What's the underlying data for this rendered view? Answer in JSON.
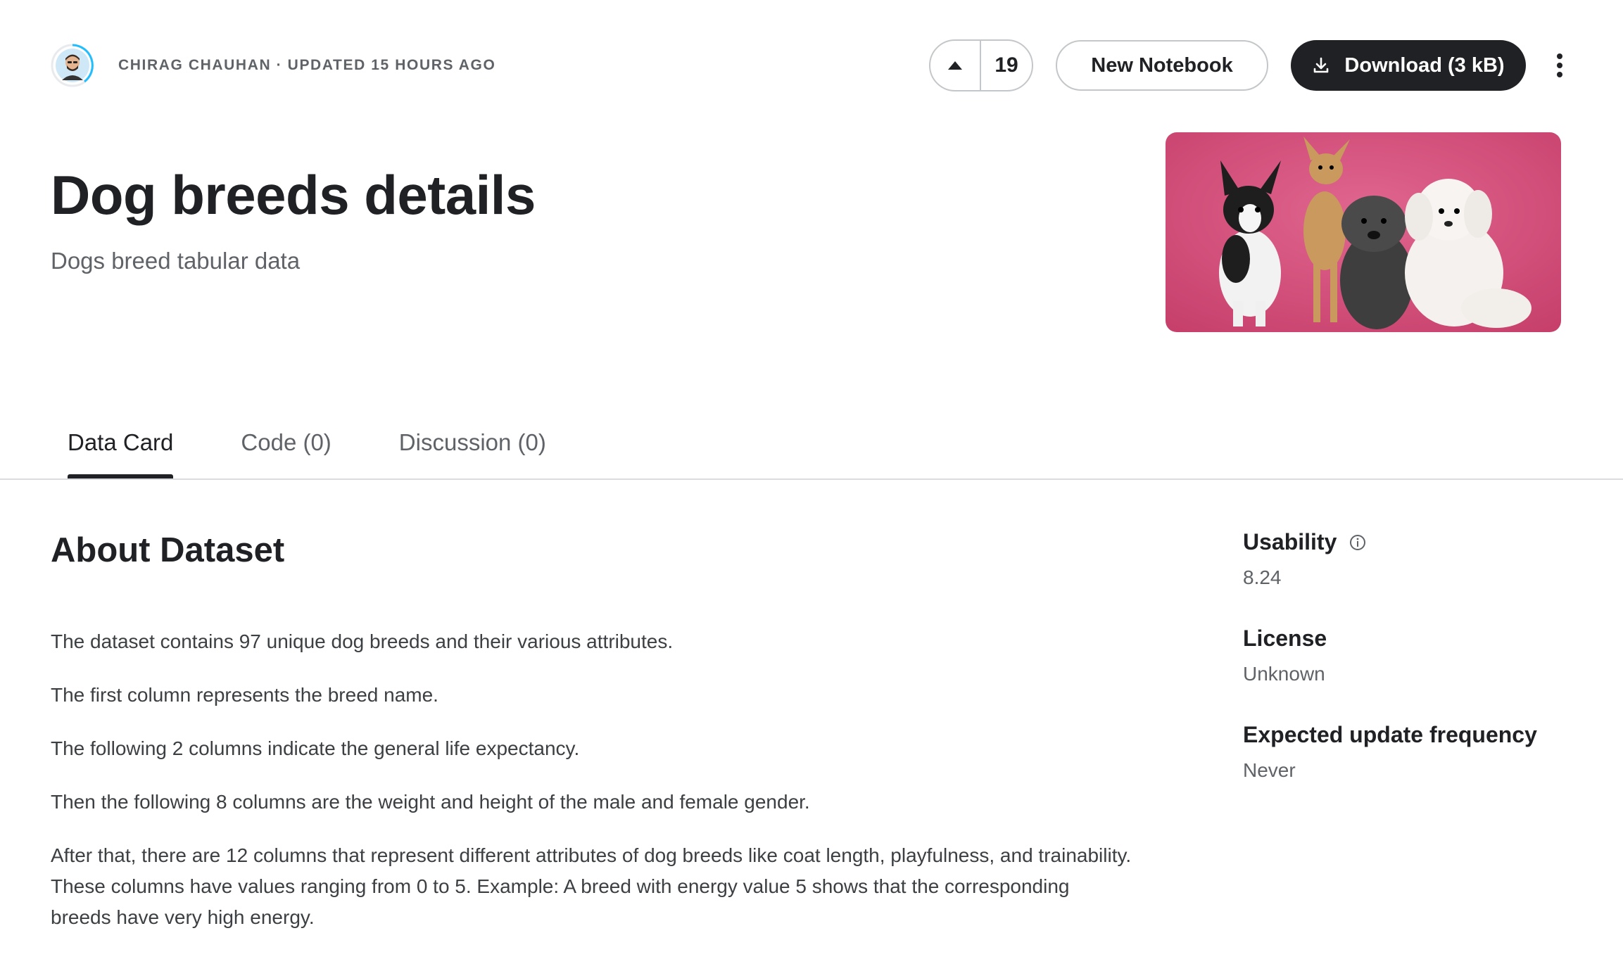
{
  "header": {
    "owner": "CHIRAG CHAUHAN · UPDATED 15 HOURS AGO",
    "vote_count": "19",
    "new_notebook_label": "New Notebook",
    "download_label": "Download (3 kB)"
  },
  "dataset": {
    "title": "Dog breeds details",
    "subtitle": "Dogs breed tabular data"
  },
  "tabs": [
    {
      "label": "Data Card",
      "active": true
    },
    {
      "label": "Code (0)",
      "active": false
    },
    {
      "label": "Discussion (0)",
      "active": false
    }
  ],
  "about": {
    "heading": "About Dataset",
    "paragraphs": [
      "The dataset contains 97 unique dog breeds and their various attributes.",
      "The first column represents the breed name.",
      "The following 2 columns indicate the general life expectancy.",
      "Then the following 8 columns are the weight and height of the male and female gender.",
      "After that, there are 12 columns that represent different attributes of dog breeds like coat length, playfulness, and trainability. These columns have values ranging from 0 to 5. Example: A breed with energy value 5 shows that the corresponding breeds have very high energy."
    ]
  },
  "meta": {
    "usability_label": "Usability",
    "usability_value": "8.24",
    "license_label": "License",
    "license_value": "Unknown",
    "frequency_label": "Expected update frequency",
    "frequency_value": "Never"
  },
  "icons": {
    "upvote": "caret-up-icon",
    "download": "download-icon",
    "more": "more-vertical-icon",
    "info": "info-icon"
  },
  "colors": {
    "primary_dark": "#202124",
    "cover_background": "#d64d7a",
    "avatar_ring": "#20beff"
  }
}
